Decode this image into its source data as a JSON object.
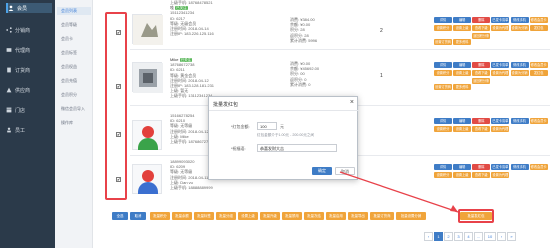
{
  "sidebar": {
    "items": [
      {
        "label": "会员",
        "icon": "user-icon"
      },
      {
        "label": "分销商",
        "icon": "share-icon"
      },
      {
        "label": "代理商",
        "icon": "agent-icon"
      },
      {
        "label": "订货商",
        "icon": "order-icon"
      },
      {
        "label": "供应商",
        "icon": "supplier-icon"
      },
      {
        "label": "门店",
        "icon": "store-icon"
      },
      {
        "label": "员工",
        "icon": "staff-icon"
      }
    ],
    "subitems": [
      "会员列表",
      "会员等级",
      "会员卡",
      "会员标签",
      "会员权益",
      "会员充值",
      "会员积分",
      "微信会员导入",
      "操作库"
    ]
  },
  "rows": [
    {
      "top_text": "上级手机: 18768478521",
      "name": "哇",
      "tag": "已关注",
      "phone": "15112341234",
      "id": "ID: 6217",
      "level": "等级: 无级会员",
      "reg": "注册时间: 2018-04-14",
      "ip": "注册IP: 183.226.125.116",
      "money": [
        "消费: ¥384.00",
        "余额: ¥0.00",
        "积分: 28",
        "返积分: 28",
        "累计消费: 5996"
      ],
      "num": "2",
      "checked": "✔"
    },
    {
      "top_text": "",
      "name": "Mike",
      "tag": "已关注",
      "phone": "18768672738",
      "id": "ID: 6211",
      "level": "等级: 黄金会员",
      "reg": "注册时间: 2018-04-12",
      "ip": "注册IP: 183.128.181.231",
      "extra": [
        "上级: 暂无",
        "上级手机: 13112341234"
      ],
      "money": [
        "消费: ¥0.00",
        "余额: ¥45692.00",
        "积分: 00",
        "返积分: 0",
        "累计消费: 0"
      ],
      "num": "1",
      "checked": "✔"
    },
    {
      "top_text": "",
      "name": "",
      "tag": "",
      "phone": "15166278254",
      "id": "ID: 6210",
      "level": "等级: 无等级",
      "reg": "注册时间: 2018-04-12",
      "ip": "上级: Mike",
      "extra": [
        "上级手机: 18768672738"
      ],
      "money": [
        "",
        "",
        "",
        "",
        ""
      ],
      "num": "",
      "checked": "✔"
    },
    {
      "top_text": "",
      "name": "",
      "tag": "",
      "phone": "18899093020",
      "id": "ID: 6209",
      "level": "等级: 无等级",
      "reg": "注册时间: 2018-04-11",
      "ip": "上级: Dan vu",
      "extra": [
        "上级手机: 18888889999"
      ],
      "money": [
        "",
        "",
        "",
        "",
        ""
      ],
      "num": "",
      "checked": "✔"
    }
  ],
  "row_ops": [
    "详情",
    "编辑",
    "删除",
    "已发卡清单",
    "修改手机",
    "修改会员卡",
    "设置积分",
    "设置上级",
    "查看下级",
    "设置为代理",
    "设置为分销",
    "发红包",
    "设置订货商",
    "更多资料",
    "返回积分条件",
    "领取积分",
    "转移下级",
    "查看标签"
  ],
  "modal": {
    "title": "批量发红包",
    "close": "×",
    "amount_label": "*红包金额:",
    "amount_value": "100",
    "amount_unit": "元",
    "amount_hint": "红包金额介于1.00元 - 200.00元之间",
    "wish_label": "*祝福语:",
    "wish_value": "恭喜发财大吉",
    "confirm": "确定",
    "cancel": "取消"
  },
  "batch_buttons": [
    "全选",
    "取消",
    "批量积分",
    "批量余额",
    "批量标签",
    "批量分组",
    "设置上级",
    "批量升级",
    "批量禁用",
    "批量冻结",
    "批量启用",
    "批量导出",
    "批量订货商",
    "批量设置分销",
    "批量发红包"
  ],
  "pager": [
    "‹",
    "1",
    "2",
    "3",
    "4",
    "…",
    "10",
    "›",
    "»"
  ],
  "colors": {
    "sidebar_bg": "#2b3a4a",
    "primary": "#3e7cc6",
    "orange": "#f0a43a",
    "red": "#e14b45",
    "highlight": "#e8424a"
  }
}
